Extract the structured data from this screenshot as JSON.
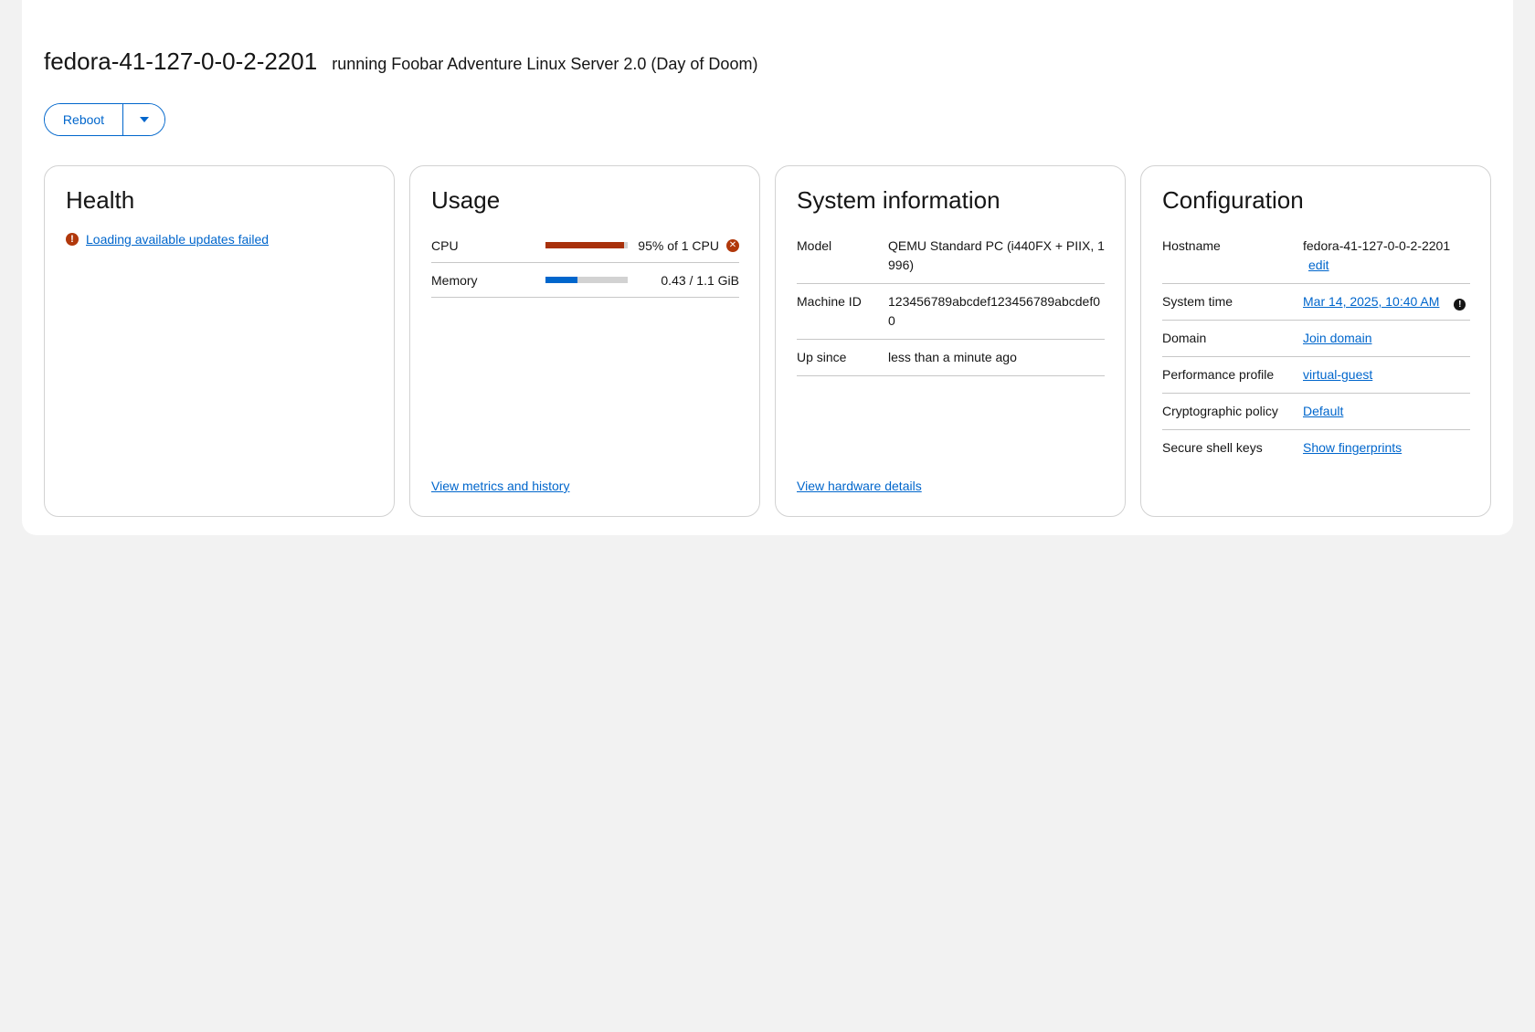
{
  "header": {
    "hostname": "fedora-41-127-0-0-2-2201",
    "os": "running Foobar Adventure Linux Server 2.0 (Day of Doom)"
  },
  "actions": {
    "reboot_label": "Reboot"
  },
  "health": {
    "title": "Health",
    "message": "Loading available updates failed"
  },
  "usage": {
    "title": "Usage",
    "cpu": {
      "label": "CPU",
      "value": "95% of 1 CPU",
      "percent": 95,
      "color": "#a8310b"
    },
    "memory": {
      "label": "Memory",
      "value": "0.43 / 1.1 GiB",
      "percent": 39,
      "color": "#0066cc"
    },
    "link": "View metrics and history"
  },
  "sysinfo": {
    "title": "System information",
    "rows": [
      {
        "key": "Model",
        "value": "QEMU Standard PC (i440FX + PIIX, 1996)"
      },
      {
        "key": "Machine ID",
        "value": "123456789abcdef123456789abcdef00"
      },
      {
        "key": "Up since",
        "value": "less than a minute ago"
      }
    ],
    "link": "View hardware details"
  },
  "config": {
    "title": "Configuration",
    "hostname_key": "Hostname",
    "hostname_value": "fedora-41-127-0-0-2-2201",
    "edit_label": "edit",
    "time_key": "System time",
    "time_value": "Mar 14, 2025, 10:40 AM",
    "domain_key": "Domain",
    "domain_value": "Join domain",
    "perf_key": "Performance profile",
    "perf_value": "virtual-guest",
    "crypto_key": "Cryptographic policy",
    "crypto_value": "Default",
    "ssh_key": "Secure shell keys",
    "ssh_value": "Show fingerprints"
  }
}
